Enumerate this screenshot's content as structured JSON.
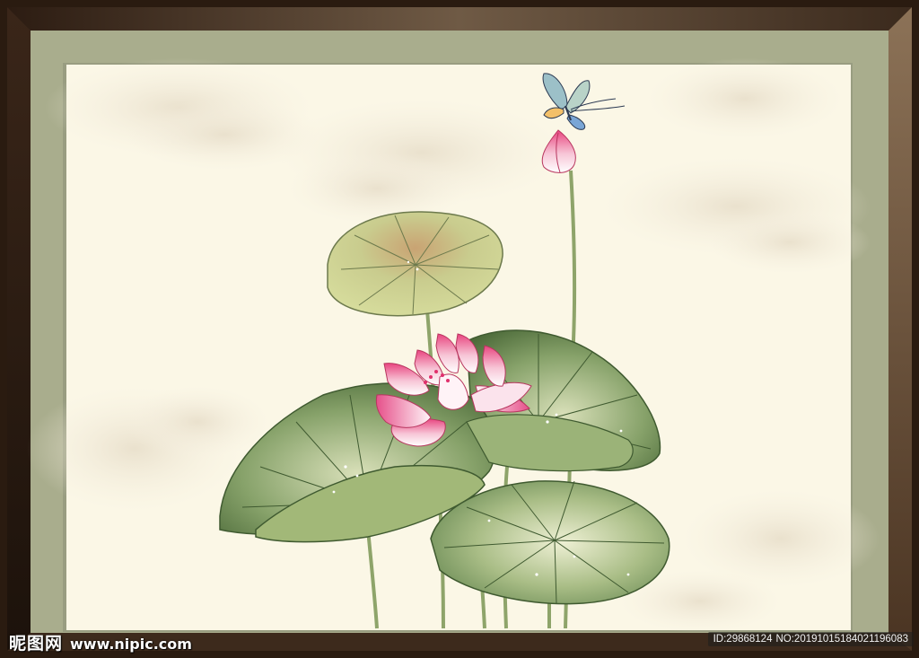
{
  "artwork": {
    "subject": "lotus",
    "colors": {
      "frame_outer_top": "#5b4333",
      "frame_outer_bottom": "#3a2619",
      "frame_inner_mat": "#a9ad8d",
      "canvas": "#fbf7e6",
      "lotus_pink": "#e45b8c",
      "leaf_green": "#7d9a58"
    }
  },
  "watermark": {
    "brand": "昵图网",
    "site": "www.nipic.com",
    "id_text": "ID:29868124",
    "no_text": "NO:20191015184021196083"
  }
}
